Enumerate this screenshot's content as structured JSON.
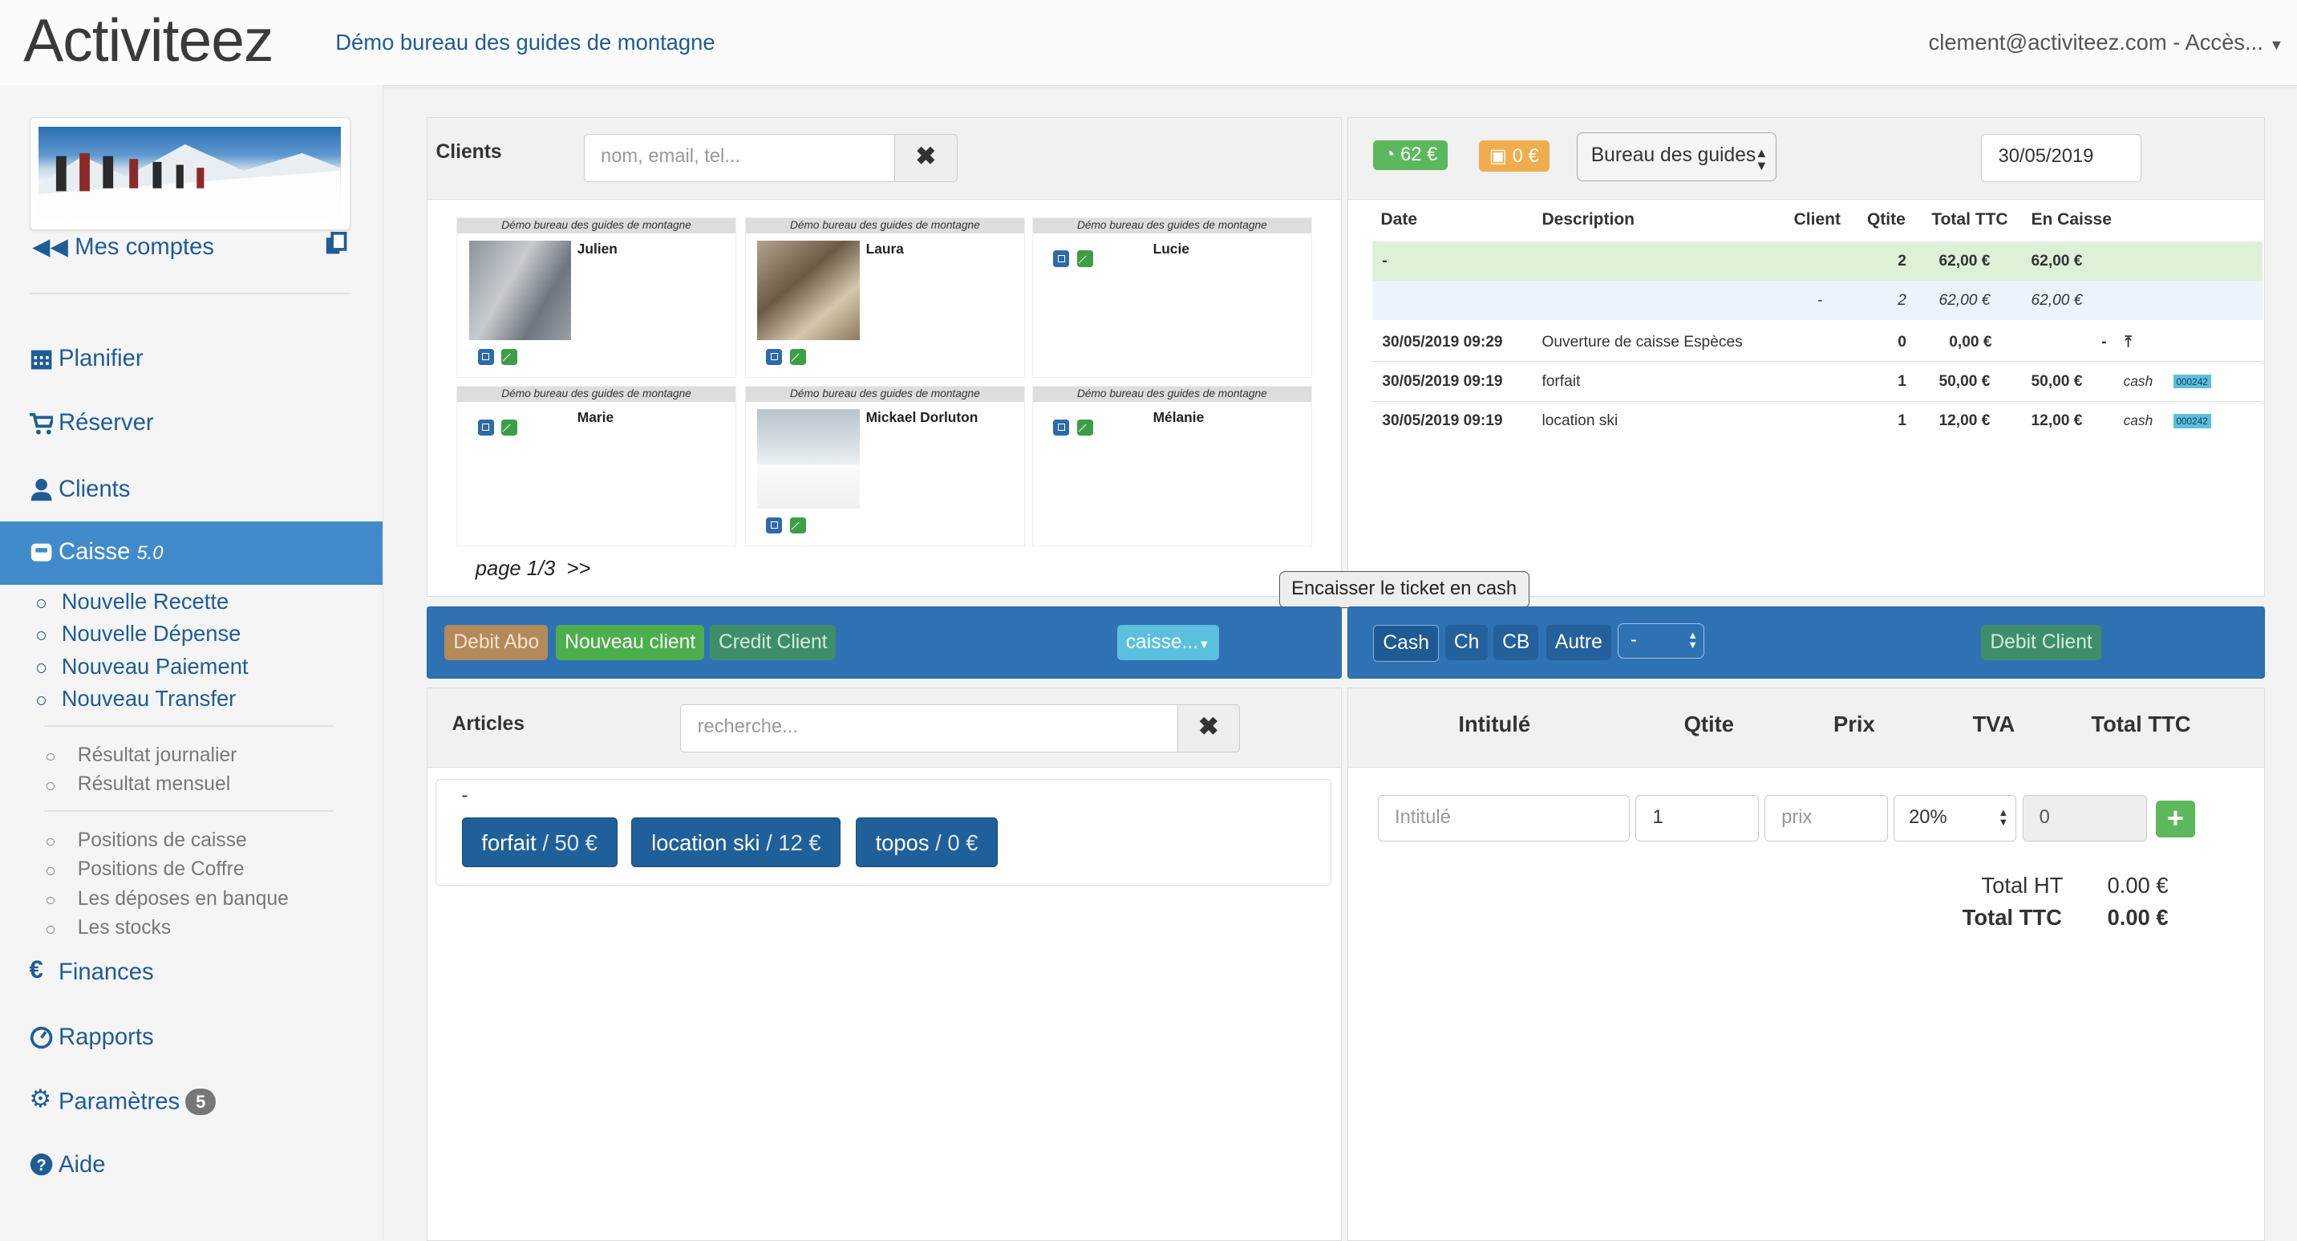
{
  "header": {
    "brand": "Activiteez",
    "subtitle": "Démo bureau des guides de montagne",
    "user": "clement@activiteez.com - Accès..."
  },
  "sidebar": {
    "mes_comptes": "Mes comptes",
    "nav": [
      {
        "label": "Planifier",
        "icon": "calendar-icon"
      },
      {
        "label": "Réserver",
        "icon": "cart-icon"
      },
      {
        "label": "Clients",
        "icon": "user-icon"
      },
      {
        "label": "Caisse",
        "version": "5.0",
        "icon": "cash-register-icon"
      },
      {
        "label": "Finances",
        "icon": "euro-icon"
      },
      {
        "label": "Rapports",
        "icon": "dashboard-icon"
      },
      {
        "label": "Paramètres",
        "badge": "5",
        "icon": "gear-icon"
      },
      {
        "label": "Aide",
        "icon": "question-icon"
      }
    ],
    "caisse_sub": [
      "Nouvelle Recette",
      "Nouvelle Dépense",
      "Nouveau Paiement",
      "Nouveau Transfer"
    ],
    "results": [
      "Résultat journalier",
      "Résultat mensuel"
    ],
    "positions": [
      "Positions de caisse",
      "Positions de Coffre",
      "Les déposes en banque",
      "Les stocks"
    ]
  },
  "clients": {
    "title": "Clients",
    "search_placeholder": "nom, email, tel...",
    "org": "Démo bureau des guides de montagne",
    "cards": [
      {
        "name": "Julien"
      },
      {
        "name": "Laura"
      },
      {
        "name": "Lucie"
      },
      {
        "name": "Marie"
      },
      {
        "name": "Mickael Dorluton"
      },
      {
        "name": "Mélanie"
      }
    ],
    "pager": "page 1/3",
    "next": ">>"
  },
  "caisse": {
    "badge_cash": "62 €",
    "badge_other": "0 €",
    "office": "Bureau des guides",
    "date": "30/05/2019",
    "columns": [
      "Date",
      "Description",
      "Client",
      "Qtite",
      "Total TTC",
      "En Caisse"
    ],
    "summary": {
      "date": "-",
      "qty": "2",
      "total": "62,00 €",
      "caisse": "62,00 €"
    },
    "subsummary": {
      "client": "-",
      "qty": "2",
      "total": "62,00 €",
      "caisse": "62,00 €"
    },
    "rows": [
      {
        "date": "30/05/2019 09:29",
        "desc": "Ouverture de caisse Espèces",
        "qty": "0",
        "total": "0,00 €",
        "caisse": "-",
        "mode": "",
        "tag": ""
      },
      {
        "date": "30/05/2019 09:19",
        "desc": "forfait",
        "qty": "1",
        "total": "50,00 €",
        "caisse": "50,00 €",
        "mode": "cash",
        "tag": "000242"
      },
      {
        "date": "30/05/2019 09:19",
        "desc": "location ski",
        "qty": "1",
        "total": "12,00 €",
        "caisse": "12,00 €",
        "mode": "cash",
        "tag": "000242"
      }
    ]
  },
  "toolbar_left": {
    "debit_abo": "Debit Abo",
    "nouveau_client": "Nouveau client",
    "credit_client": "Credit Client",
    "caisse_menu": "caisse..."
  },
  "toolbar_right": {
    "cash": "Cash",
    "ch": "Ch",
    "cb": "CB",
    "autre": "Autre",
    "select": "-",
    "debit_client": "Debit Client",
    "tooltip": "Encaisser le ticket en cash"
  },
  "articles": {
    "title": "Articles",
    "search_placeholder": "recherche...",
    "group": "-",
    "items": [
      {
        "name": "forfait",
        "price": "50 €"
      },
      {
        "name": "location ski",
        "price": "12 €"
      },
      {
        "name": "topos",
        "price": "0 €"
      }
    ]
  },
  "ticket": {
    "columns": [
      "Intitulé",
      "Qtite",
      "Prix",
      "TVA",
      "Total TTC"
    ],
    "intitule_placeholder": "Intitulé",
    "qty_value": "1",
    "prix_placeholder": "prix",
    "tva_value": "20%",
    "total_value": "0",
    "total_ht_label": "Total HT",
    "total_ht": "0.00 €",
    "total_ttc_label": "Total TTC",
    "total_ttc": "0.00 €"
  },
  "colors": {
    "accent": "#428bca",
    "link": "#1f5c95",
    "green": "#5cb85c",
    "orange": "#f0ad4e"
  }
}
